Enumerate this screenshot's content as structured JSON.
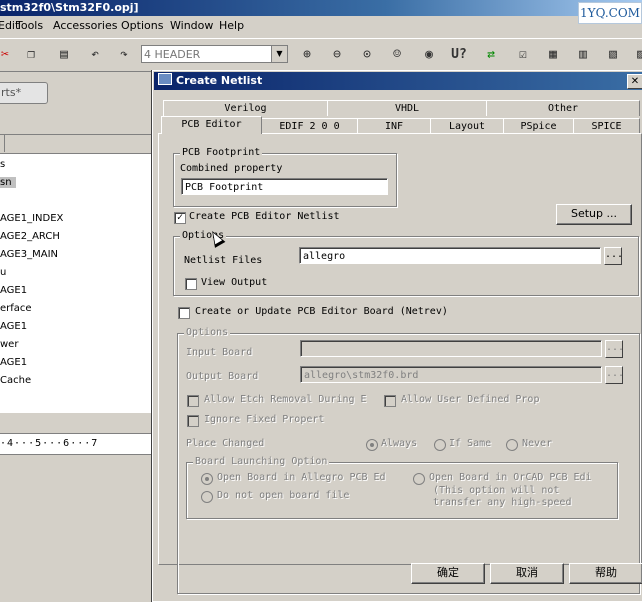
{
  "app": {
    "title": "stm32f0\\Stm32F0.opj]",
    "watermark": "1YQ.COM",
    "menu": [
      "Edit",
      "Tools",
      "Accessories",
      "Options",
      "Window",
      "Help"
    ],
    "toolbar_combo": "4 HEADER",
    "open_tab": "rts*",
    "ruler": "·4···5···6···7",
    "tree_items": [
      {
        "label": "s",
        "selected": false
      },
      {
        "label": "sn",
        "selected": true
      },
      {
        "label": "",
        "selected": false
      },
      {
        "label": "AGE1_INDEX",
        "selected": false
      },
      {
        "label": "AGE2_ARCH",
        "selected": false
      },
      {
        "label": "AGE3_MAIN",
        "selected": false
      },
      {
        "label": "u",
        "selected": false
      },
      {
        "label": "AGE1",
        "selected": false
      },
      {
        "label": "erface",
        "selected": false
      },
      {
        "label": "AGE1",
        "selected": false
      },
      {
        "label": "wer",
        "selected": false
      },
      {
        "label": "AGE1",
        "selected": false
      },
      {
        "label": "Cache",
        "selected": false
      }
    ]
  },
  "dialog": {
    "title": "Create Netlist",
    "tabs_back": [
      "Verilog",
      "VHDL",
      "Other"
    ],
    "tabs_front": [
      "PCB Editor",
      "EDIF 2 0 0",
      "INF",
      "Layout",
      "PSpice",
      "SPICE"
    ],
    "active_tab": "PCB Editor",
    "footprint_group": {
      "title": "PCB Footprint",
      "combined_label": "Combined property",
      "combined_value": "PCB Footprint"
    },
    "create_netlist": {
      "label": "Create PCB Editor Netlist",
      "checked": true
    },
    "setup_button": "Setup ...",
    "options1": {
      "title": "Options",
      "netlist_files_label": "Netlist Files",
      "netlist_files_value": "allegro",
      "browse": "...",
      "view_output_label": "View Output",
      "view_output_checked": false
    },
    "update_board": {
      "label": "Create or Update PCB Editor Board (Netrev)",
      "checked": false
    },
    "options2": {
      "title": "Options",
      "input_board_label": "Input Board",
      "input_board_value": "",
      "output_board_label": "Output Board",
      "output_board_value": "allegro\\stm32f0.brd",
      "allow_etch_label": "Allow Etch Removal During E",
      "allow_user_label": "Allow User Defined Prop",
      "ignore_fixed_label": "Ignore Fixed Propert",
      "place_changed_label": "Place Changed",
      "place_options": [
        "Always",
        "If Same",
        "Never"
      ],
      "place_selected": "Always",
      "launch_group": {
        "title": "Board Launching Option",
        "open_allegro": "Open Board in Allegro PCB Ed",
        "open_orcad": "Open Board in OrCAD PCB Edi",
        "orcad_note_1": "(This option will not",
        "orcad_note_2": "transfer any high-speed",
        "do_not_open": "Do not open board file",
        "selected": "open_allegro"
      }
    },
    "buttons": {
      "ok": "确定",
      "cancel": "取消",
      "help": "帮助"
    }
  }
}
